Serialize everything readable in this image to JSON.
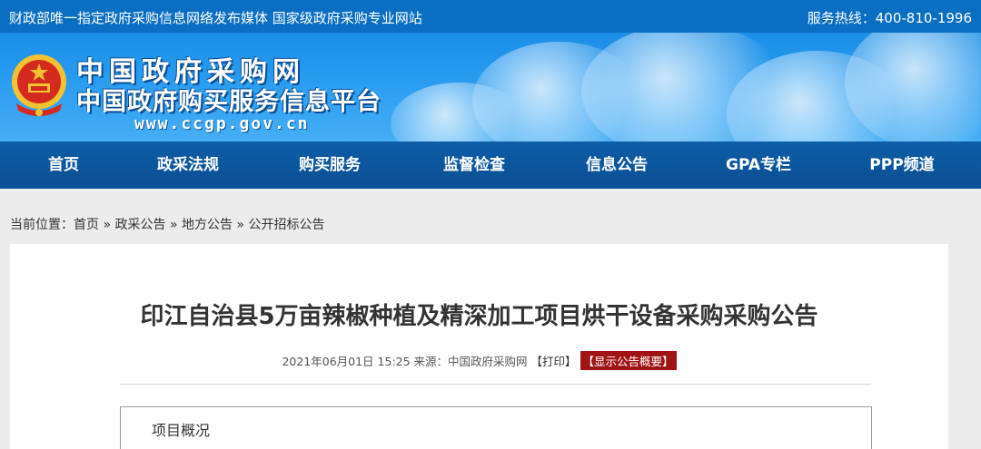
{
  "topbar": {
    "tagline": "财政部唯一指定政府采购信息网络发布媒体 国家级政府采购专业网站",
    "hotline": "服务热线：400-810-1996"
  },
  "header": {
    "logo_line1": "中国政府采购网",
    "logo_line2": "中国政府购买服务信息平台",
    "logo_url": "www.ccgp.gov.cn",
    "emblem_icon": "national-emblem-icon"
  },
  "nav": {
    "items": [
      "首页",
      "政采法规",
      "购买服务",
      "监督检查",
      "信息公告",
      "GPA专栏",
      "PPP频道"
    ]
  },
  "breadcrumb": {
    "prefix": "当前位置：",
    "items": [
      "首页",
      "政采公告",
      "地方公告",
      "公开招标公告"
    ],
    "separator": "»"
  },
  "article": {
    "title": "印江自治县5万亩辣椒种植及精深加工项目烘干设备采购采购公告",
    "datetime": "2021年06月01日 15:25",
    "source": "来源：中国政府采购网",
    "print_label": "【打印】",
    "summary_label": "【显示公告概要】",
    "section_label": "项目概况"
  },
  "colors": {
    "topbar_bg": "#0a6fc2",
    "nav_bg": "#0d5ea8",
    "summary_badge": "#a01414"
  }
}
